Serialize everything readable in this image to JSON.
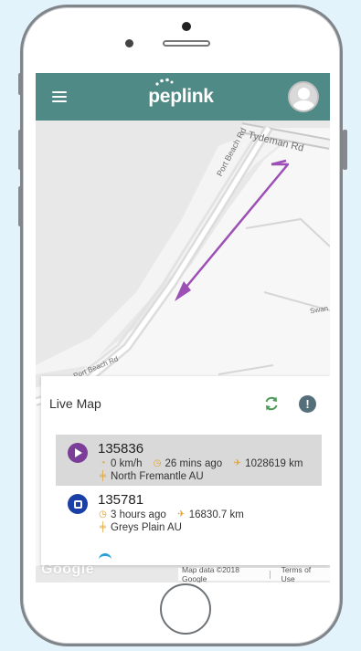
{
  "colors": {
    "appbar": "#4f8a86",
    "route": "#9c4fb4",
    "play_badge": "#7b3d98",
    "stop_badge": "#1a3fa6",
    "meta_icon": "#e0a030"
  },
  "app": {
    "menu_icon": "menu-icon",
    "logo": "peplink",
    "avatar_icon": "user-avatar-icon"
  },
  "map": {
    "streets": {
      "tydeman": "Tydeman Rd",
      "port_beach_top": "Port Beach Rd",
      "port_beach_bottom": "Port Beach Rd",
      "swan": "Swan S"
    },
    "google_logo": "Google",
    "attribution": "Map data ©2018 Google",
    "terms": "Terms of Use",
    "zoom_in": "+",
    "zoom_out": "−"
  },
  "panel": {
    "title": "Live Map",
    "refresh_icon": "refresh-icon",
    "alert_icon": "alert-icon",
    "alert_glyph": "!",
    "devices": [
      {
        "id": "135836",
        "status_icon": "play-icon",
        "speed": "0 km/h",
        "time": "26 mins ago",
        "distance": "1028619 km",
        "location": "North Fremantle AU"
      },
      {
        "id": "135781",
        "status_icon": "stop-icon",
        "time": "3 hours ago",
        "distance": "16830.7 km",
        "location": "Greys Plain AU"
      }
    ]
  }
}
